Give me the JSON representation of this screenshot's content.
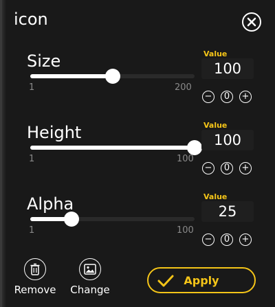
{
  "panel": {
    "title": "icon",
    "close_icon": "close-circle-icon"
  },
  "colors": {
    "accent": "#f5c518",
    "background": "#191919",
    "track": "#2a2a2a"
  },
  "sliders": [
    {
      "label": "Size",
      "min": "1",
      "max": "200",
      "value": "100",
      "value_label": "Value",
      "fraction": 0.5
    },
    {
      "label": "Height",
      "min": "1",
      "max": "100",
      "value": "100",
      "value_label": "Value",
      "fraction": 1.0
    },
    {
      "label": "Alpha",
      "min": "1",
      "max": "100",
      "value": "25",
      "value_label": "Value",
      "fraction": 0.25
    }
  ],
  "controls": {
    "minus": "−",
    "zero": "0",
    "plus": "+"
  },
  "actions": {
    "remove_label": "Remove",
    "remove_icon": "trash-icon",
    "change_label": "Change",
    "change_icon": "image-icon",
    "apply_label": "Apply",
    "apply_icon": "checkmark-icon"
  }
}
